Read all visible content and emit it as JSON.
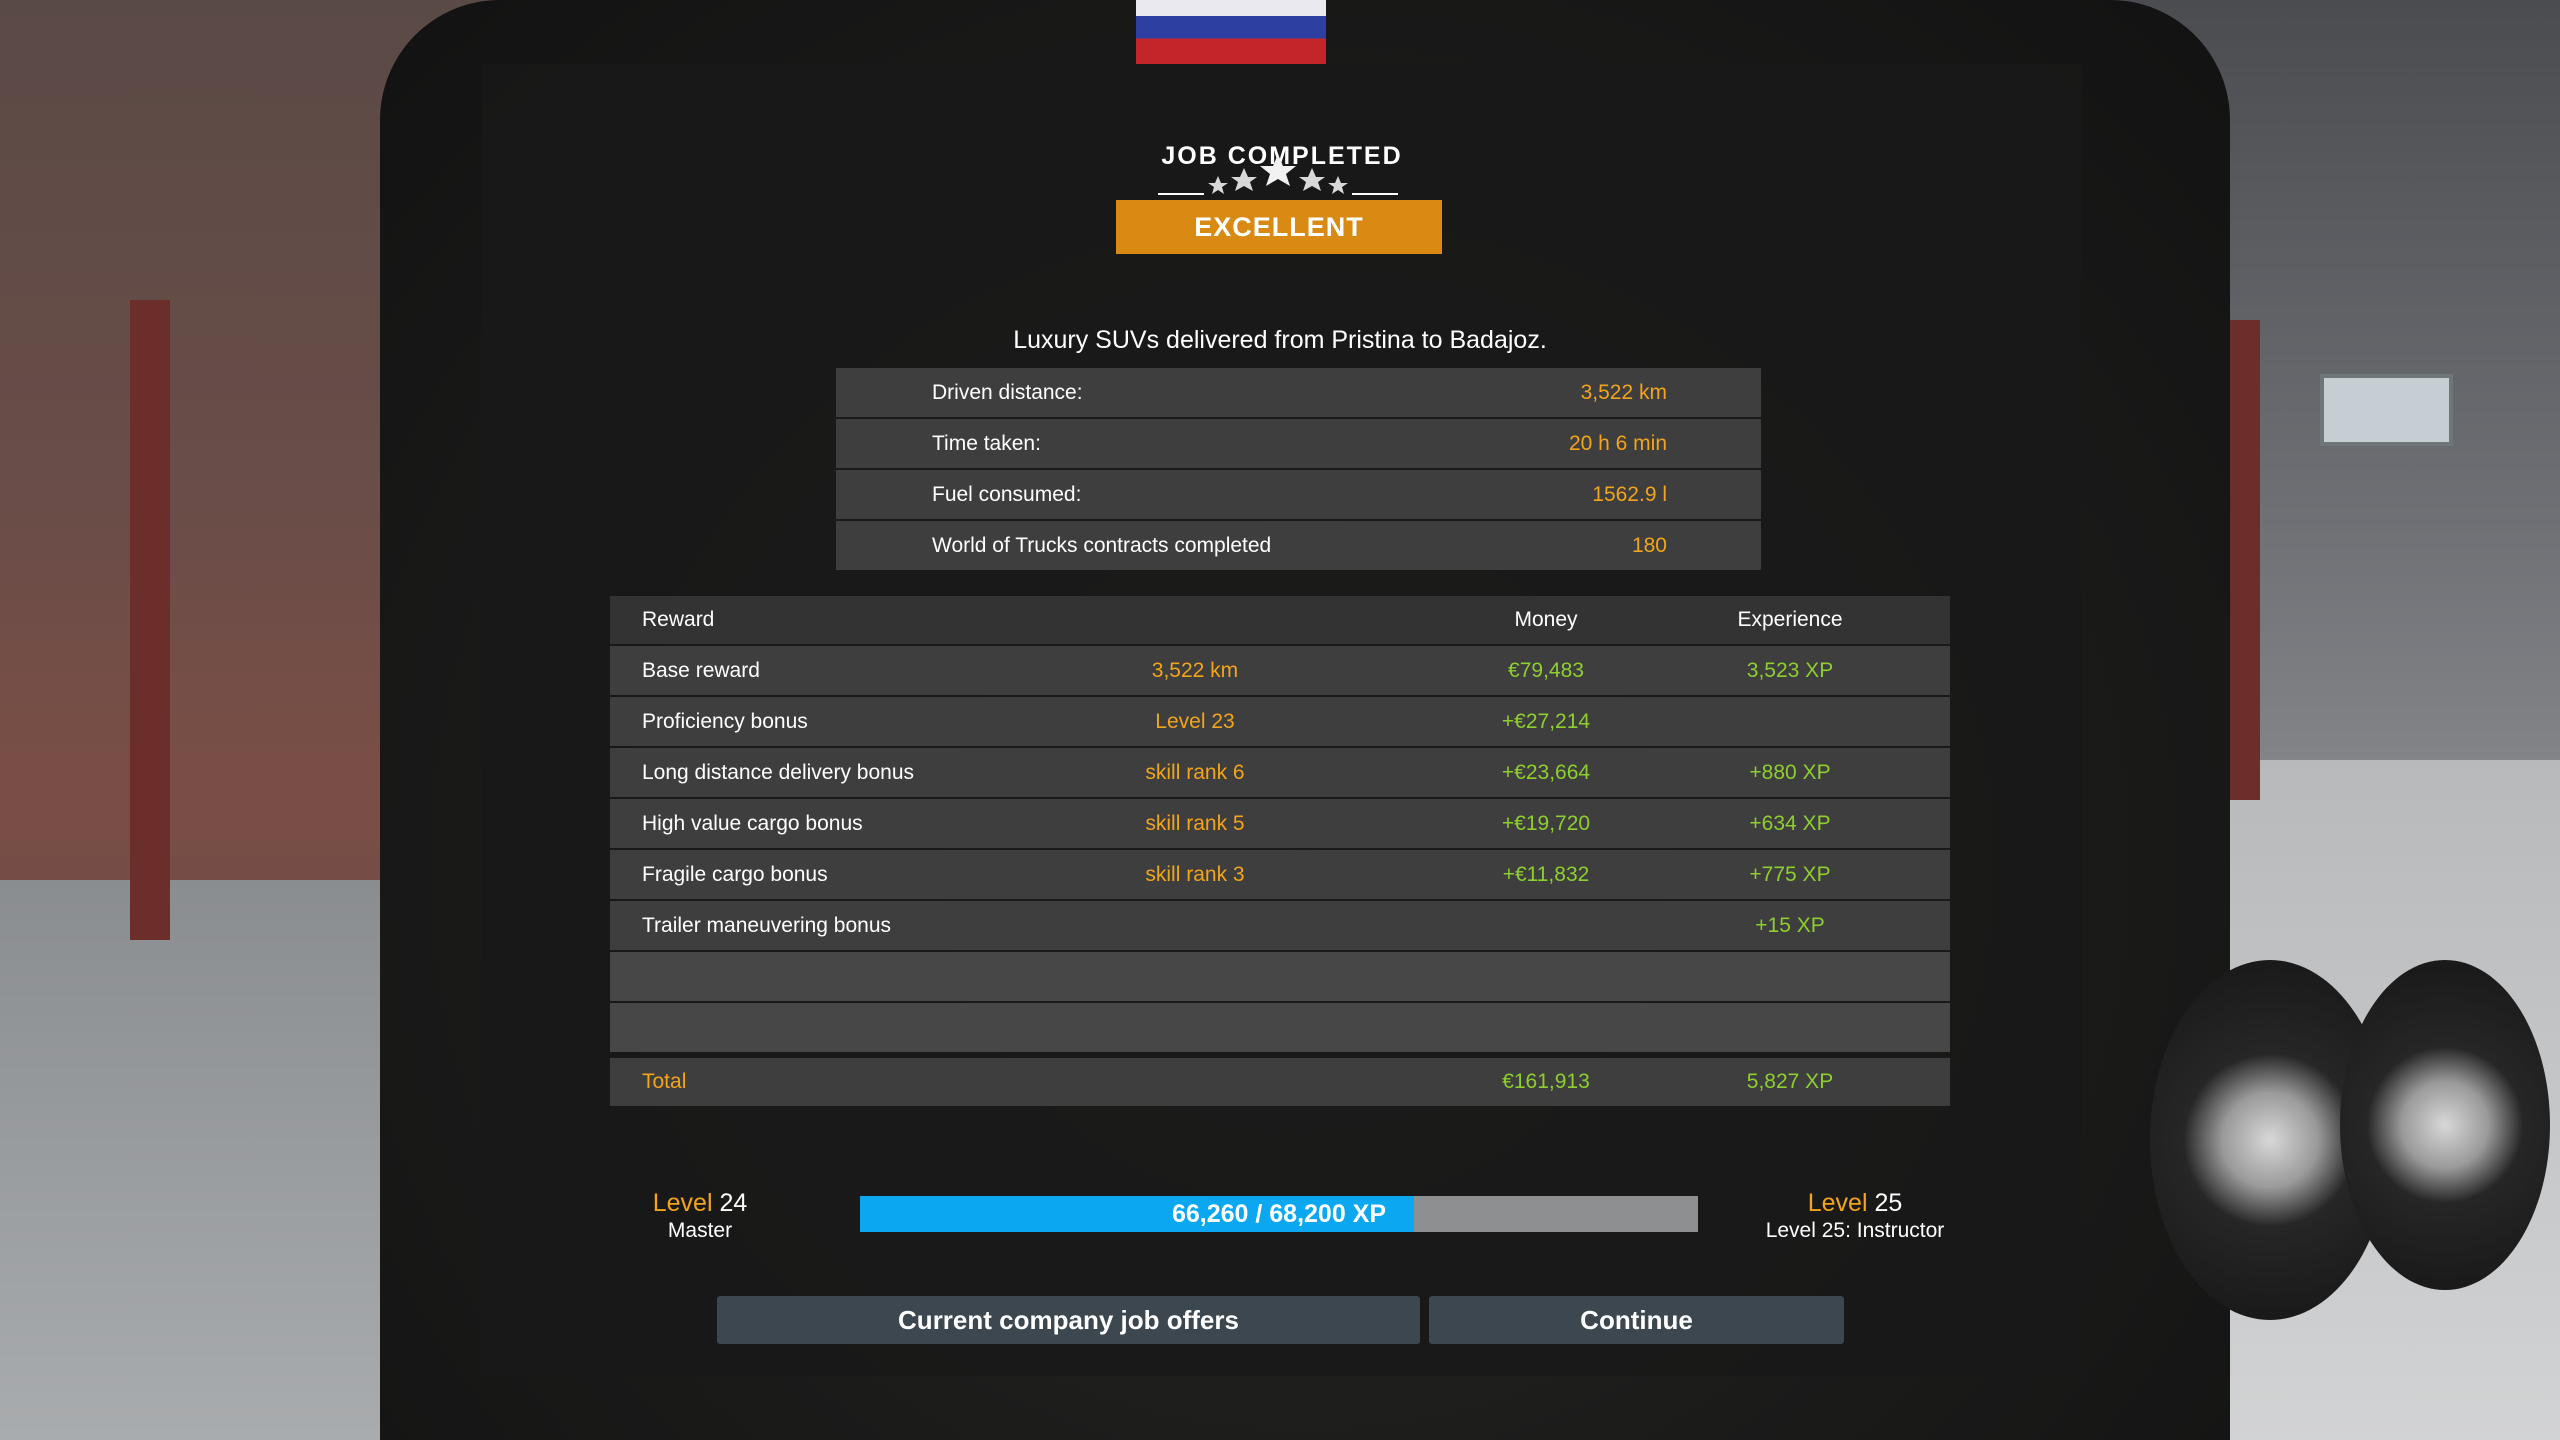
{
  "dialog": {
    "title": "JOB COMPLETED",
    "rating": "EXCELLENT",
    "summary": "Luxury SUVs delivered from Pristina to Badajoz."
  },
  "stats": [
    {
      "label": "Driven distance:",
      "value": "3,522 km"
    },
    {
      "label": "Time taken:",
      "value": "20 h 6 min"
    },
    {
      "label": "Fuel consumed:",
      "value": "1562.9 l"
    },
    {
      "label": "World of Trucks contracts completed",
      "value": "180"
    }
  ],
  "reward_table": {
    "headers": {
      "reward": "Reward",
      "money": "Money",
      "experience": "Experience"
    },
    "rows": [
      {
        "label": "Base reward",
        "detail": "3,522 km",
        "money": "€79,483",
        "xp": "3,523 XP"
      },
      {
        "label": "Proficiency bonus",
        "detail": "Level 23",
        "money": "+€27,214",
        "xp": ""
      },
      {
        "label": "Long distance delivery bonus",
        "detail": "skill rank 6",
        "money": "+€23,664",
        "xp": "+880 XP"
      },
      {
        "label": "High value cargo bonus",
        "detail": "skill rank 5",
        "money": "+€19,720",
        "xp": "+634 XP"
      },
      {
        "label": "Fragile cargo bonus",
        "detail": "skill rank 3",
        "money": "+€11,832",
        "xp": "+775 XP"
      },
      {
        "label": "Trailer maneuvering bonus",
        "detail": "",
        "money": "",
        "xp": "+15 XP"
      }
    ],
    "total": {
      "label": "Total",
      "money": "€161,913",
      "xp": "5,827 XP"
    }
  },
  "progress": {
    "current_level_word": "Level",
    "current_level_number": "24",
    "current_title": "Master",
    "xp_text": "66,260 / 68,200 XP",
    "xp_fraction": 0.6606,
    "next_level_word": "Level",
    "next_level_number": "25",
    "next_title": "Level 25: Instructor"
  },
  "buttons": {
    "job_offers": "Current company job offers",
    "continue": "Continue"
  },
  "colors": {
    "accent_orange": "#f2a41b",
    "rating_bg": "#d98a12",
    "money_green": "#8ecf2f",
    "xp_blue": "#0ba7f0"
  }
}
